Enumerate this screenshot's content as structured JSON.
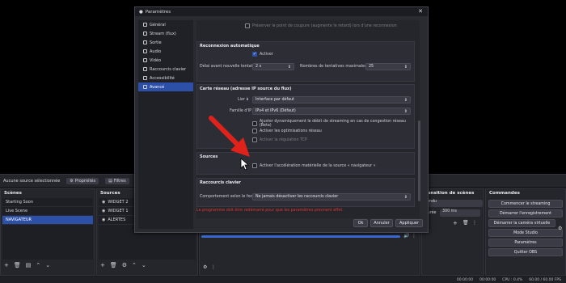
{
  "controls_bar": {
    "no_source": "Aucune source sélectionnée",
    "properties": "Propriétés",
    "filters": "Filtres"
  },
  "scenes": {
    "title": "Scènes",
    "items": [
      "Starting Soon",
      "Live Scene",
      "NAVIGATEUR"
    ],
    "selected": 2
  },
  "sources": {
    "title": "Sources",
    "items": [
      "WIDGET 2",
      "WIDGET 1",
      "ALERTES"
    ]
  },
  "transitions": {
    "title": "ransition de scènes",
    "type": "ondu",
    "duration_label": "Durée",
    "duration": "300 ms"
  },
  "commands": {
    "title": "Commandes",
    "buttons": [
      "Commencer le streaming",
      "Démarrer l'enregistrement",
      "Démarrer la caméra virtuelle",
      "Mode Studio",
      "Paramètres",
      "Quitter OBS"
    ]
  },
  "status": {
    "time1": "00:00:00",
    "time2": "00:00:00",
    "cpu": "CPU : 0.4%",
    "fps": "60.00 / 60.00 FPS"
  },
  "dialog": {
    "title": "Paramètres",
    "nav": [
      {
        "label": "Général",
        "icon": "gear-icon"
      },
      {
        "label": "Stream (flux)",
        "icon": "globe-icon"
      },
      {
        "label": "Sortie",
        "icon": "output-icon"
      },
      {
        "label": "Audio",
        "icon": "speaker-icon"
      },
      {
        "label": "Vidéo",
        "icon": "monitor-icon"
      },
      {
        "label": "Raccourcis clavier",
        "icon": "keyboard-icon"
      },
      {
        "label": "Accessibilité",
        "icon": "accessibility-icon"
      },
      {
        "label": "Avancé",
        "icon": "wrench-icon"
      }
    ],
    "selected_nav": 7,
    "top_cut": "Préserver le point de coupure (augmente le retard) lors d'une reconnexion",
    "reconnect": {
      "title": "Reconnexion automatique",
      "enable": "Activer",
      "delay_label": "Délai avant nouvelle tentative",
      "delay": "2 s",
      "max_label": "Nombres de tentatives maximales",
      "max": "25"
    },
    "network": {
      "title": "Carte réseau (adresse IP source du flux)",
      "bind_label": "Lier à",
      "bind": "Interface par défaut",
      "ip_label": "Famille d'IP",
      "ip": "IPv4 et IPv6 (Défaut)",
      "dyn": "Ajuster dynamiquement le débit de streaming en cas de congestion réseau (Beta)",
      "opt": "Activer les optimisations réseau",
      "tcp": "Activer la régulation TCP"
    },
    "sources_grp": {
      "title": "Sources",
      "hw": "Activer l'accélération matérielle de la source « navigateur »"
    },
    "hotkeys": {
      "title": "Raccourcis clavier",
      "focus_label": "Comportement selon le focus",
      "focus": "Ne jamais désactiver les raccourcis clavier"
    },
    "warning": "Le programme doit être redémarré pour que les paramètres prennent effet.",
    "ok": "Ok",
    "cancel": "Annuler",
    "apply": "Appliquer"
  }
}
